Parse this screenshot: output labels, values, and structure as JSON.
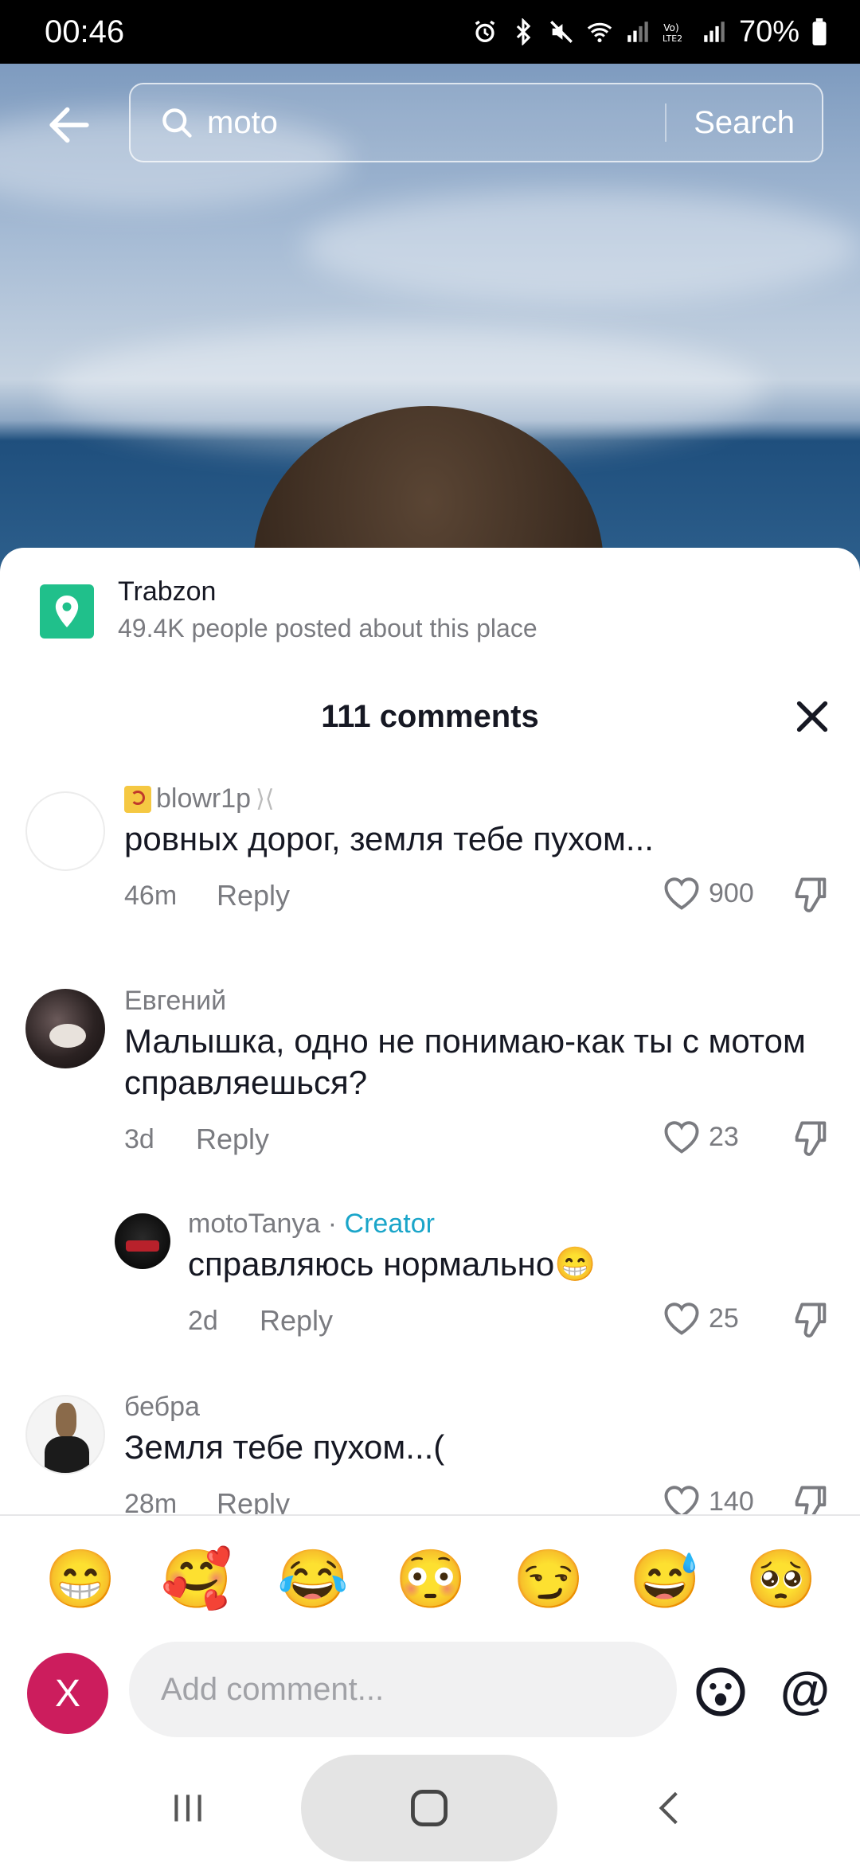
{
  "status_bar": {
    "time": "00:46",
    "battery": "70%",
    "icons": [
      "alarm-icon",
      "bluetooth-icon",
      "mute-icon",
      "wifi-icon",
      "signal-icon",
      "volte-icon",
      "signal-icon",
      "battery-icon"
    ]
  },
  "search": {
    "query": "moto",
    "button_label": "Search"
  },
  "place": {
    "name": "Trabzon",
    "subtitle": "49.4K people posted about this place",
    "accent": "#20c08b"
  },
  "comments_header": {
    "title": "111 comments"
  },
  "comments": [
    {
      "username": "blowr1p",
      "text": "ровных дорог, земля тебе пухом...",
      "time": "46m",
      "reply_label": "Reply",
      "likes": "900"
    },
    {
      "username": "Евгений",
      "text": "Малышка, одно не понимаю-как ты с мотом справляешься?",
      "time": "3d",
      "reply_label": "Reply",
      "likes": "23"
    },
    {
      "username": "motoTanya",
      "badge": "Creator",
      "separator": " · ",
      "text": "справляюсь нормально😁",
      "time": "2d",
      "reply_label": "Reply",
      "likes": "25"
    },
    {
      "username": "бебра",
      "text": "Земля тебе пухом...(",
      "time": "28m",
      "reply_label": "Reply",
      "likes": "140"
    }
  ],
  "emoji_bar": [
    "😁",
    "🥰",
    "😂",
    "😳",
    "😏",
    "😅",
    "🥺"
  ],
  "composer": {
    "avatar_letter": "X",
    "placeholder": "Add comment...",
    "at_label": "@",
    "avatar_color": "#cc1d5d"
  },
  "colors": {
    "creator": "#1aa5c9",
    "muted": "#7a7b80"
  }
}
